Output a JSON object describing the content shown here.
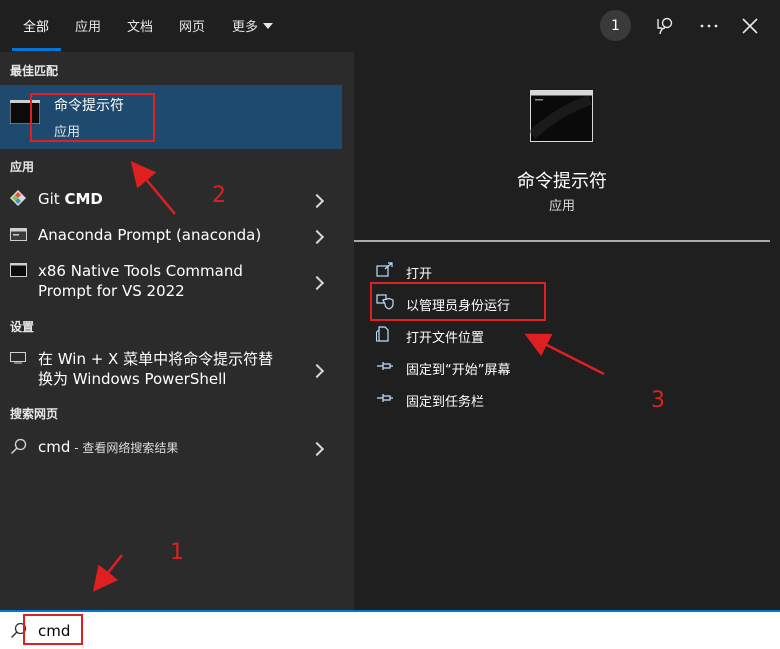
{
  "tabs": [
    {
      "label": "全部"
    },
    {
      "label": "应用"
    },
    {
      "label": "文档"
    },
    {
      "label": "网页"
    },
    {
      "label": "更多"
    }
  ],
  "top_right": {
    "badge_count": "1"
  },
  "left": {
    "best_match_header": "最佳匹配",
    "best_match": {
      "title": "命令提示符",
      "subtitle": "应用"
    },
    "apps_header": "应用",
    "apps": [
      {
        "label_plain": "Git ",
        "label_bold": "CMD",
        "icon": "git-icon"
      },
      {
        "label": "Anaconda Prompt (anaconda)",
        "icon": "terminal-icon"
      },
      {
        "line1": "x86 Native Tools Command",
        "line2": "Prompt for VS 2022",
        "icon": "cmd-icon"
      }
    ],
    "settings_header": "设置",
    "settings": [
      {
        "line1": "在 Win + X 菜单中将命令提示符替",
        "line2": "换为 Windows PowerShell",
        "icon": "monitor-icon"
      }
    ],
    "web_header": "搜索网页",
    "web": [
      {
        "query": "cmd",
        "suffix": " - 查看网络搜索结果",
        "icon": "search-icon"
      }
    ]
  },
  "right": {
    "title": "命令提示符",
    "subtitle": "应用",
    "actions": [
      {
        "label": "打开",
        "icon": "open-icon"
      },
      {
        "label": "以管理员身份运行",
        "icon": "shield-icon"
      },
      {
        "label": "打开文件位置",
        "icon": "file-location-icon"
      },
      {
        "label": "固定到“开始”屏幕",
        "icon": "pin-icon"
      },
      {
        "label": "固定到任务栏",
        "icon": "pin-icon"
      }
    ]
  },
  "search": {
    "value": "cmd"
  },
  "annotations": {
    "step1": "1",
    "step2": "2",
    "step3": "3",
    "color": "#e02020"
  }
}
